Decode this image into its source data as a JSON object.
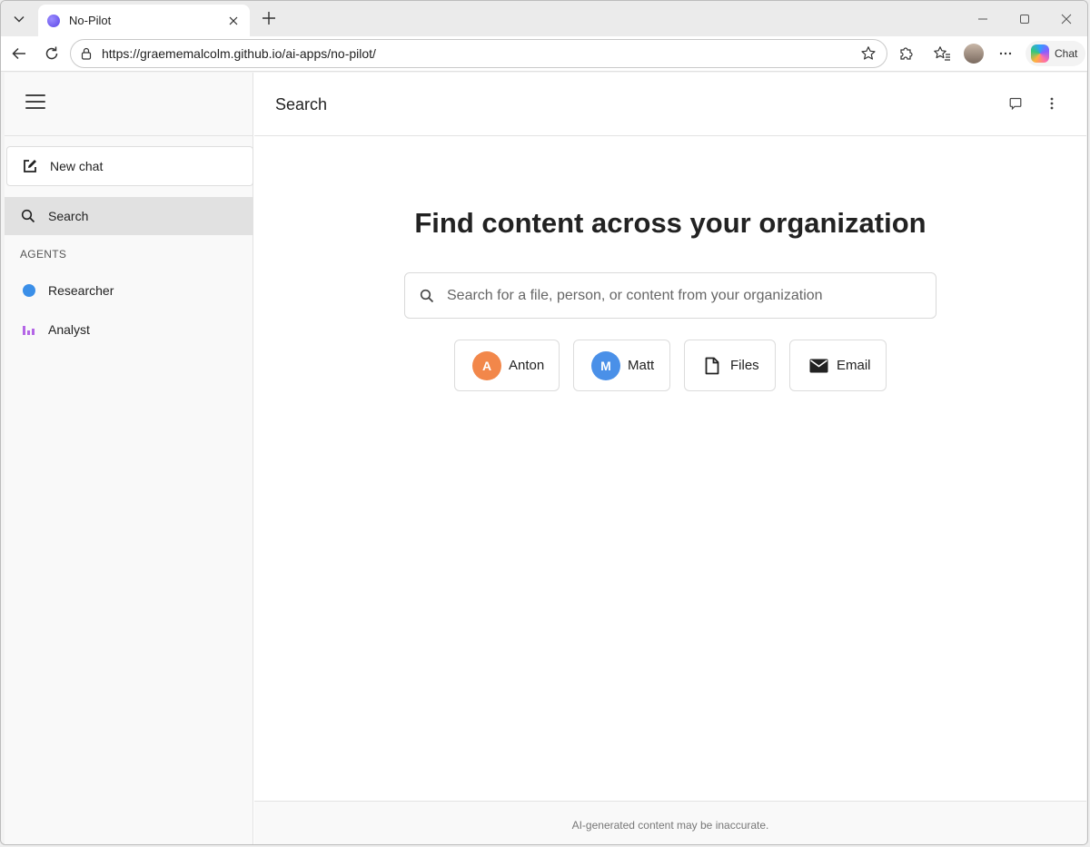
{
  "browser": {
    "tab_title": "No-Pilot",
    "url": "https://graememalcolm.github.io/ai-apps/no-pilot/",
    "chat_label": "Chat"
  },
  "sidebar": {
    "new_chat": "New chat",
    "search": "Search",
    "agents_heading": "AGENTS",
    "agents": [
      {
        "label": "Researcher",
        "icon": "blue-dot-icon",
        "color": "#3b8fe8"
      },
      {
        "label": "Analyst",
        "icon": "bar-chart-icon",
        "color": "#b466e6"
      }
    ]
  },
  "main": {
    "title": "Search",
    "hero": "Find content across your organization",
    "search_placeholder": "Search for a file, person, or content from your organization",
    "chips": [
      {
        "label": "Anton",
        "initial": "A",
        "color": "#f2874a"
      },
      {
        "label": "Matt",
        "initial": "M",
        "color": "#4a90e8"
      },
      {
        "label": "Files",
        "icon": "file-icon"
      },
      {
        "label": "Email",
        "icon": "email-icon"
      }
    ],
    "footer": "AI-generated content may be inaccurate."
  }
}
